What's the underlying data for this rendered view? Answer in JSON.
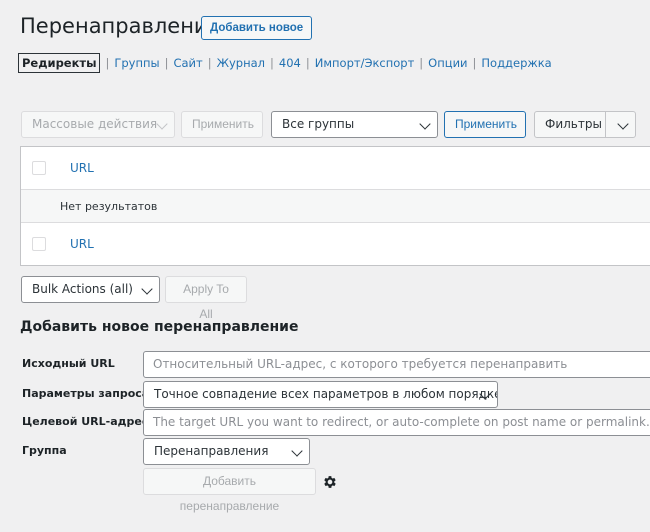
{
  "header": {
    "title": "Перенаправления",
    "add_new_label": "Добавить новое"
  },
  "subnav": {
    "items": [
      {
        "label": "Редиректы",
        "current": true
      },
      {
        "label": "Группы"
      },
      {
        "label": "Сайт"
      },
      {
        "label": "Журнал"
      },
      {
        "label": "404"
      },
      {
        "label": "Импорт/Экспорт"
      },
      {
        "label": "Опции"
      },
      {
        "label": "Поддержка"
      }
    ]
  },
  "toolbar": {
    "bulk_actions": "Массовые действия",
    "apply_disabled": "Применить",
    "groups_select": "Все группы",
    "apply": "Применить",
    "filters": "Фильтры"
  },
  "table": {
    "header_col": "URL",
    "empty_text": "Нет результатов",
    "footer_col": "URL"
  },
  "bottom_toolbar": {
    "bulk_all": "Bulk Actions (all)",
    "apply_to_all": "Apply To All"
  },
  "form": {
    "title": "Добавить новое перенаправление",
    "source_label": "Исходный URL",
    "source_placeholder": "Относительный URL-адрес, с которого требуется перенаправить",
    "query_label": "Параметры запроса",
    "query_value": "Точное совпадение всех параметров в любом порядке",
    "target_label": "Целевой URL-адрес",
    "target_placeholder": "The target URL you want to redirect, or auto-complete on post name or permalink.",
    "group_label": "Группа",
    "group_value": "Перенаправления",
    "submit_label": "Добавить перенаправление"
  },
  "icons": {
    "gear": "gear-icon"
  },
  "colors": {
    "accent": "#2271b1",
    "background": "#f0f0f1"
  }
}
